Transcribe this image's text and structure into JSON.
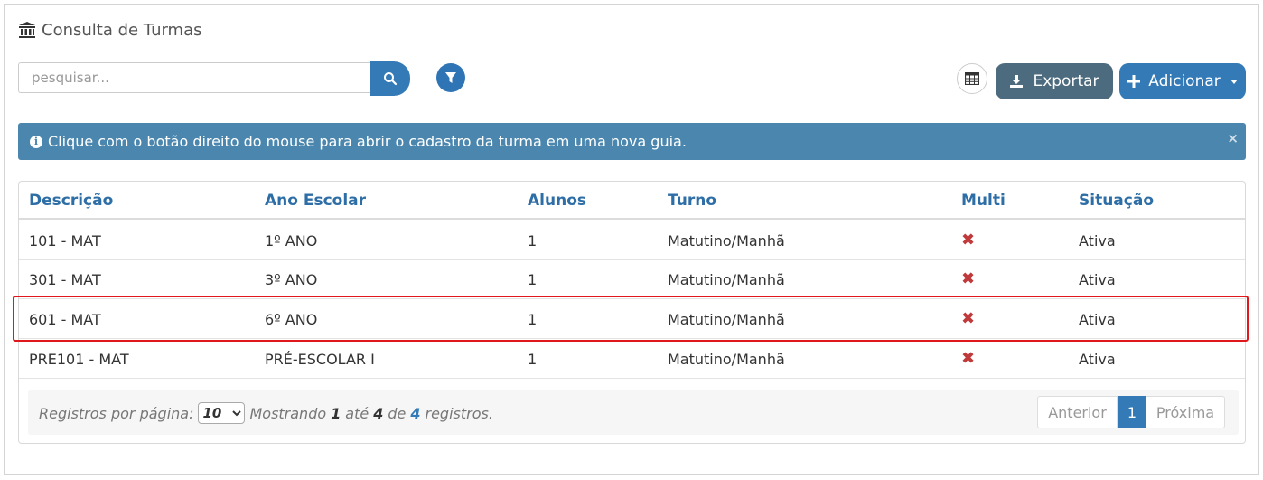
{
  "header": {
    "title": "Consulta de Turmas",
    "icon": "bank-icon"
  },
  "search": {
    "placeholder": "pesquisar...",
    "value": ""
  },
  "toolbar": {
    "export_label": "Exportar",
    "add_label": "Adicionar"
  },
  "alert": {
    "message": "Clique com o botão direito do mouse para abrir o cadastro da turma em uma nova guia.",
    "close": "×"
  },
  "table": {
    "columns": [
      "Descrição",
      "Ano Escolar",
      "Alunos",
      "Turno",
      "Multi",
      "Situação"
    ],
    "rows": [
      {
        "descricao": "101 - MAT",
        "ano": "1º ANO",
        "alunos": "1",
        "turno": "Matutino/Manhã",
        "multi": "✖",
        "situacao": "Ativa"
      },
      {
        "descricao": "301 - MAT",
        "ano": "3º ANO",
        "alunos": "1",
        "turno": "Matutino/Manhã",
        "multi": "✖",
        "situacao": "Ativa"
      },
      {
        "descricao": "601 - MAT",
        "ano": "6º ANO",
        "alunos": "1",
        "turno": "Matutino/Manhã",
        "multi": "✖",
        "situacao": "Ativa"
      },
      {
        "descricao": "PRE101 - MAT",
        "ano": "PRÉ-ESCOLAR I",
        "alunos": "1",
        "turno": "Matutino/Manhã",
        "multi": "✖",
        "situacao": "Ativa"
      }
    ]
  },
  "footer": {
    "per_page_label": "Registros por página:",
    "per_page_value": "10",
    "showing": "Mostrando",
    "from": "1",
    "to_word": "até",
    "to": "4",
    "of_word": "de",
    "total": "4",
    "suffix": "registros."
  },
  "pager": {
    "prev": "Anterior",
    "current": "1",
    "next": "Próxima"
  },
  "colors": {
    "primary": "#337ab7",
    "export": "#4d6b7e",
    "alert": "#4a86ad",
    "highlight": "#e0181b",
    "xmark": "#c0393b"
  }
}
